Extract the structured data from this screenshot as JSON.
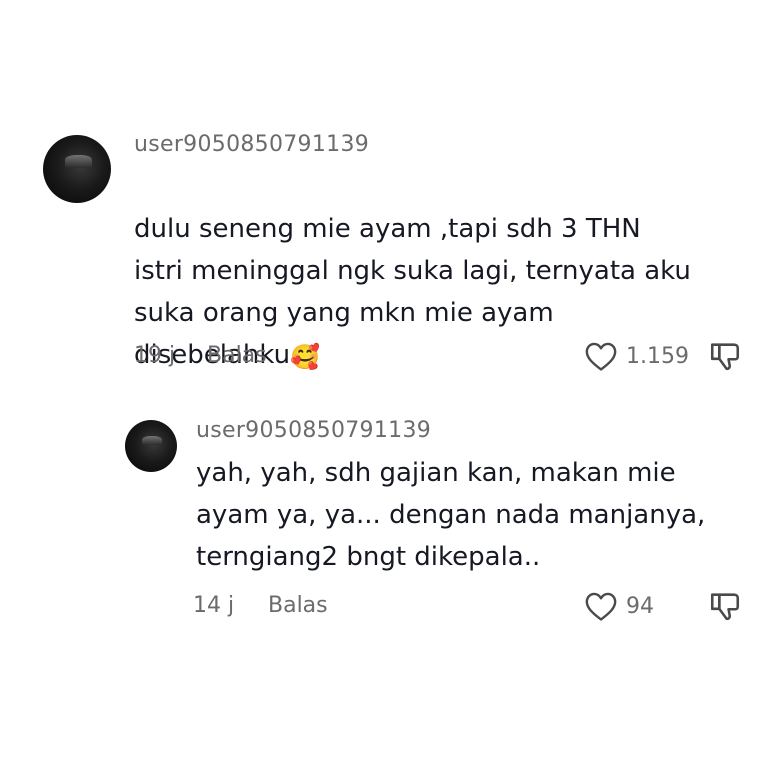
{
  "comments": [
    {
      "username": "user9050850791139",
      "text": "dulu seneng mie ayam ,tapi sdh 3 THN\nistri meninggal ngk suka lagi, ternyata aku\nsuka orang yang mkn mie ayam\ndisebelahku",
      "emoji": "🥰",
      "time": "19 j",
      "reply_label": "Balas",
      "likes": "1.159"
    },
    {
      "username": "user9050850791139",
      "text": "yah, yah, sdh gajian kan, makan mie\nayam ya, ya... dengan nada manjanya,\nterngiang2 bngt dikepala..",
      "time": "14 j",
      "reply_label": "Balas",
      "likes": "94"
    }
  ],
  "icons": {
    "like": "heart-outline-icon",
    "dislike": "thumbs-down-outline-icon"
  }
}
